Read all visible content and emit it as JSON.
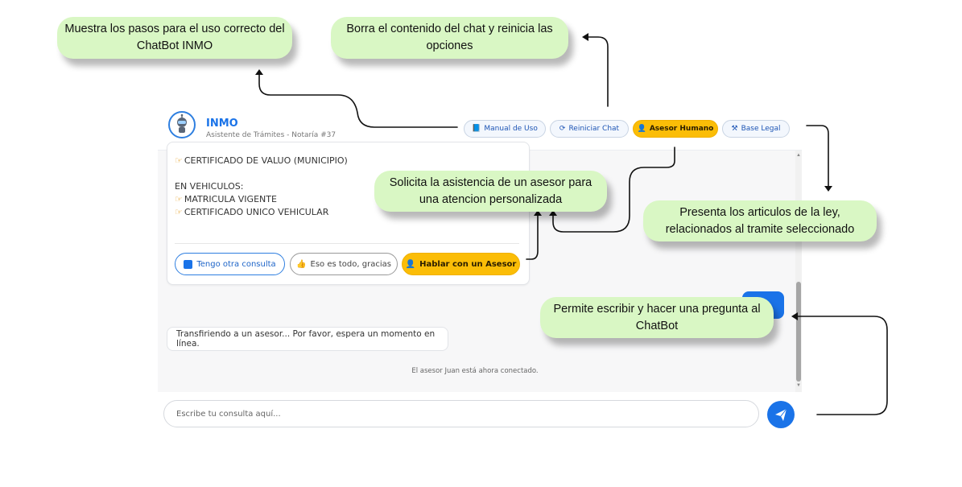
{
  "header": {
    "brand": "INMO",
    "subtitle": "Asistente de Trámites - Notaría #37",
    "buttons": {
      "manual": "Manual de Uso",
      "reiniciar": "Reiniciar Chat",
      "asesor": "Asesor Humano",
      "legal": "Base Legal"
    }
  },
  "chat": {
    "lines": {
      "cert_valuo": "CERTIFICADO DE VALUO (MUNICIPIO)",
      "vehiculos": "EN VEHICULOS:",
      "matricula": "MATRICULA VIGENTE",
      "cert_vehicular": "CERTIFICADO UNICO VEHICULAR"
    },
    "options": {
      "otra": "Tengo otra consulta",
      "todo": "Eso es todo, gracias",
      "hablar": "Hablar con un Asesor"
    },
    "transfer_message": "Transfiriendo a un asesor... Por favor, espera un momento en línea.",
    "system_message": "El asesor Juan está ahora conectado."
  },
  "input": {
    "placeholder": "Escribe tu consulta aquí..."
  },
  "callouts": {
    "manual": "Muestra los pasos para el uso correcto del ChatBot INMO",
    "reiniciar": "Borra el contenido del chat y reinicia las opciones",
    "asesor": "Solicita la asistencia de un asesor para una atencion personalizada",
    "legal": "Presenta los articulos de la ley, relacionados al tramite seleccionado",
    "input": "Permite escribir y hacer una pregunta al ChatBot"
  },
  "colors": {
    "accent": "#1a73e8",
    "gold": "#fbbd07",
    "callout": "#d9f7c4"
  }
}
